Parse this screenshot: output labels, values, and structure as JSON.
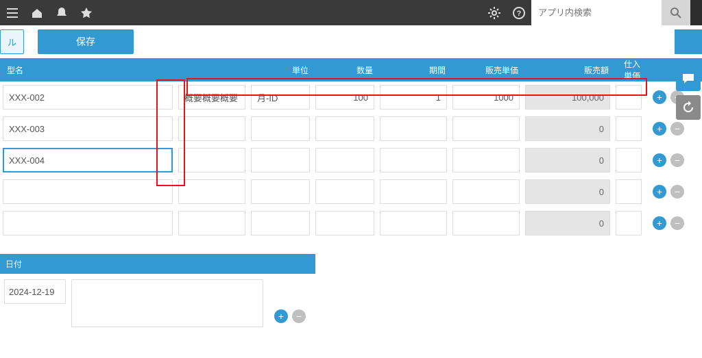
{
  "topbar": {
    "search_placeholder": "アプリ内検索"
  },
  "actionbar": {
    "ghost_tab_label": "ル",
    "save_label": "保存"
  },
  "table": {
    "headers": {
      "name": "型名",
      "unit": "単位",
      "qty": "数量",
      "term": "期間",
      "unit_price": "販売単価",
      "amount": "販売額",
      "cost": "仕入単価"
    },
    "rows": [
      {
        "name": "XXX-002",
        "desc": "概要概要概要",
        "unit": "月-ID",
        "qty": "100",
        "term": "1",
        "unit_price": "1000",
        "amount": "100,000"
      },
      {
        "name": "XXX-003",
        "desc": "",
        "unit": "",
        "qty": "",
        "term": "",
        "unit_price": "",
        "amount": "0"
      },
      {
        "name": "XXX-004",
        "desc": "",
        "unit": "",
        "qty": "",
        "term": "",
        "unit_price": "",
        "amount": "0",
        "active": true
      },
      {
        "name": "",
        "desc": "",
        "unit": "",
        "qty": "",
        "term": "",
        "unit_price": "",
        "amount": "0"
      },
      {
        "name": "",
        "desc": "",
        "unit": "",
        "qty": "",
        "term": "",
        "unit_price": "",
        "amount": "0"
      }
    ]
  },
  "date_panel": {
    "header": "日付",
    "value": "2024-12-19"
  }
}
